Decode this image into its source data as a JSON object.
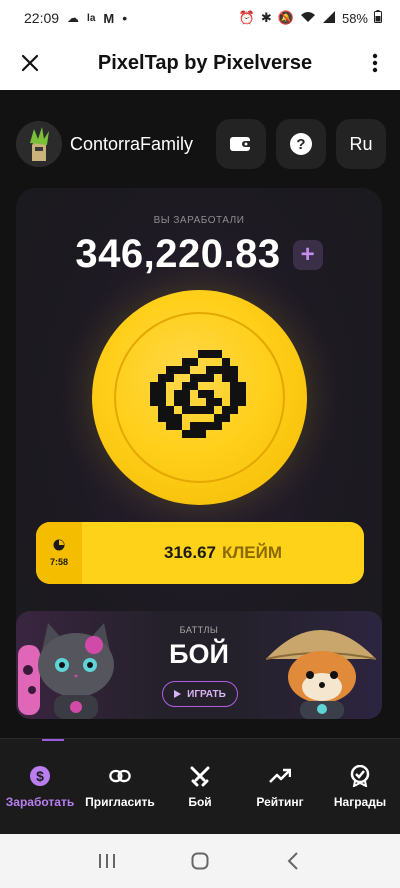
{
  "status_bar": {
    "time": "22:09",
    "battery": "58%"
  },
  "header": {
    "title": "PixelTap by Pixelverse"
  },
  "user": {
    "name": "ContorraFamily",
    "lang_label": "Ru"
  },
  "earn": {
    "label": "ВЫ ЗАРАБОТАЛИ",
    "balance": "346,220.83",
    "plus": "+"
  },
  "claim": {
    "timer": "7:58",
    "amount": "316.67",
    "label": "КЛЕЙМ"
  },
  "battle": {
    "subtitle": "БАТТЛЫ",
    "title": "БОЙ",
    "play_label": "ИГРАТЬ"
  },
  "nav": {
    "items": [
      {
        "label": "Заработать",
        "icon": "dollar-icon",
        "active": true
      },
      {
        "label": "Пригласить",
        "icon": "link-icon",
        "active": false
      },
      {
        "label": "Бой",
        "icon": "swords-icon",
        "active": false
      },
      {
        "label": "Рейтинг",
        "icon": "trending-up-icon",
        "active": false
      },
      {
        "label": "Награды",
        "icon": "badge-icon",
        "active": false
      }
    ]
  },
  "colors": {
    "accent": "#b97ff0",
    "coin": "#ffd21a",
    "background": "#121212"
  }
}
